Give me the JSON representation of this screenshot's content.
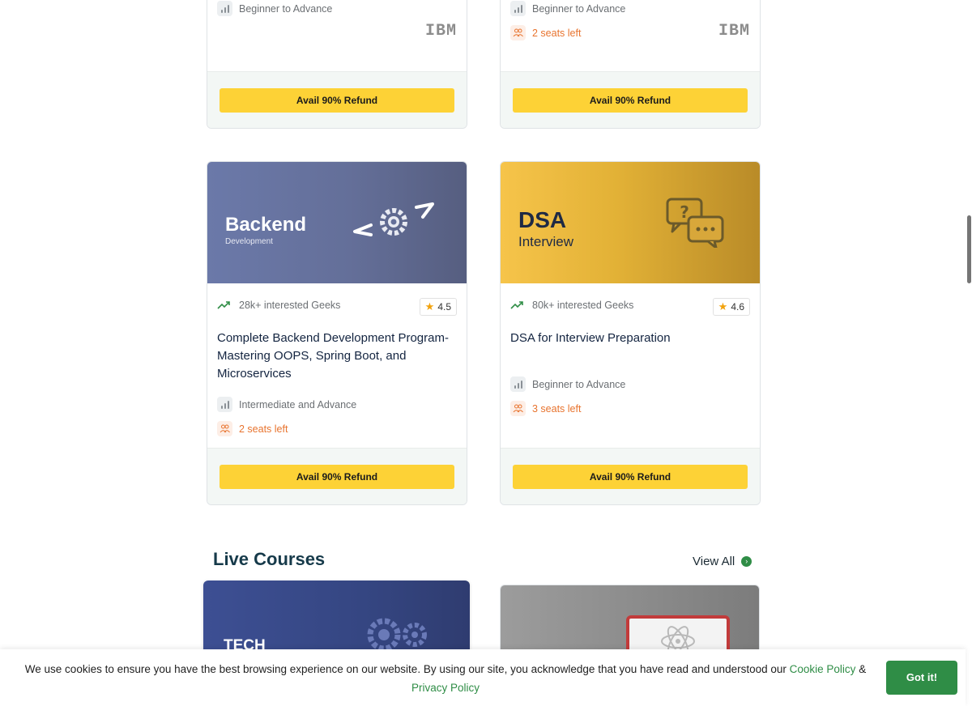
{
  "colors": {
    "accent_green": "#2f8d46",
    "refund_yellow": "#fdd236",
    "seats_orange": "#e8742f",
    "title_navy": "#163a4a"
  },
  "top_cards": [
    {
      "level": "Beginner to Advance",
      "seats": "",
      "brand": "IBM",
      "button": "Avail 90% Refund"
    },
    {
      "level": "Beginner to Advance",
      "seats": "2 seats left",
      "brand": "IBM",
      "button": "Avail 90% Refund"
    }
  ],
  "courses": [
    {
      "banner_title": "Backend",
      "banner_sub": "Development",
      "interest": "28k+ interested Geeks",
      "rating": "4.5",
      "title": "Complete Backend Development Program- Mastering OOPS, Spring Boot, and Microservices",
      "level": "Intermediate and Advance",
      "seats": "2 seats left",
      "button": "Avail 90% Refund"
    },
    {
      "banner_title": "DSA",
      "banner_sub": "Interview",
      "interest": "80k+ interested Geeks",
      "rating": "4.6",
      "title": "DSA for Interview Preparation",
      "level": "Beginner to Advance",
      "seats": "3 seats left",
      "button": "Avail 90% Refund"
    }
  ],
  "live_section": {
    "title": "Live Courses",
    "view_all": "View All"
  },
  "live_cards": [
    {
      "banner_title": "TECH"
    }
  ],
  "cookie": {
    "text": "We use cookies to ensure you have the best browsing experience on our website. By using our site, you acknowledge that you have read and understood our",
    "cookie_policy": "Cookie Policy",
    "amp": "&",
    "privacy_policy": "Privacy Policy",
    "button": "Got it!"
  }
}
